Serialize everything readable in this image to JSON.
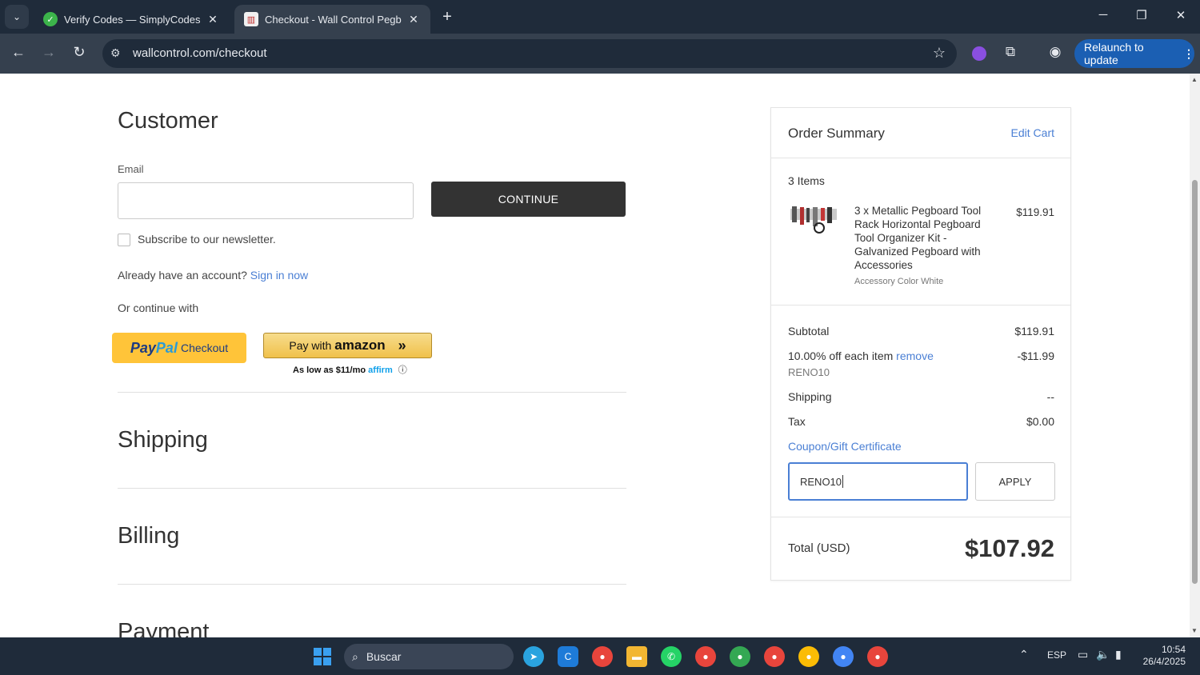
{
  "browser": {
    "tabs": [
      {
        "title": "Verify Codes — SimplyCodes",
        "active": false
      },
      {
        "title": "Checkout - Wall Control Pegboard",
        "active": true
      }
    ],
    "url": "wallcontrol.com/checkout",
    "relaunch_label": "Relaunch to update"
  },
  "checkout": {
    "customer_heading": "Customer",
    "email_label": "Email",
    "email_value": "",
    "continue_label": "CONTINUE",
    "newsletter_label": "Subscribe to our newsletter.",
    "account_prompt": "Already have an account?",
    "sign_in_link": "Sign in now",
    "continue_with": "Or continue with",
    "paypal": {
      "pay": "Pay",
      "pal": "Pal",
      "checkout": "Checkout"
    },
    "amazon": {
      "pay_with": "Pay with",
      "brand": "amazon",
      "chevron": "»"
    },
    "affirm_line": "As low as $11/mo",
    "affirm_brand": "affirm",
    "info_icon": "ⓘ",
    "shipping_heading": "Shipping",
    "billing_heading": "Billing",
    "payment_heading": "Payment"
  },
  "summary": {
    "title": "Order Summary",
    "edit_cart": "Edit Cart",
    "items_count": "3 Items",
    "product": {
      "name": "3 x Metallic Pegboard Tool Rack Horizontal Pegboard Tool Organizer Kit - Galvanized Pegboard with Accessories",
      "variant": "Accessory Color White",
      "price": "$119.91"
    },
    "rows": {
      "subtotal_label": "Subtotal",
      "subtotal_value": "$119.91",
      "discount_label": "10.00% off each item",
      "discount_remove": "remove",
      "discount_value": "-$11.99",
      "discount_code": "RENO10",
      "shipping_label": "Shipping",
      "shipping_value": "--",
      "tax_label": "Tax",
      "tax_value": "$0.00"
    },
    "coupon_link": "Coupon/Gift Certificate",
    "coupon_value": "RENO10",
    "apply_label": "APPLY",
    "total_label": "Total (USD)",
    "total_value": "$107.92"
  },
  "taskbar": {
    "search_placeholder": "Buscar",
    "language": "ESP",
    "time": "10:54",
    "date": "26/4/2025"
  },
  "colors": {
    "link": "#4a7fd4",
    "continue_bg": "#333333",
    "paypal_yellow": "#ffc439",
    "amazon_gold": "#f0c14b",
    "chrome_dark": "#1f2b3a",
    "relaunch_blue": "#1b5fb3"
  }
}
